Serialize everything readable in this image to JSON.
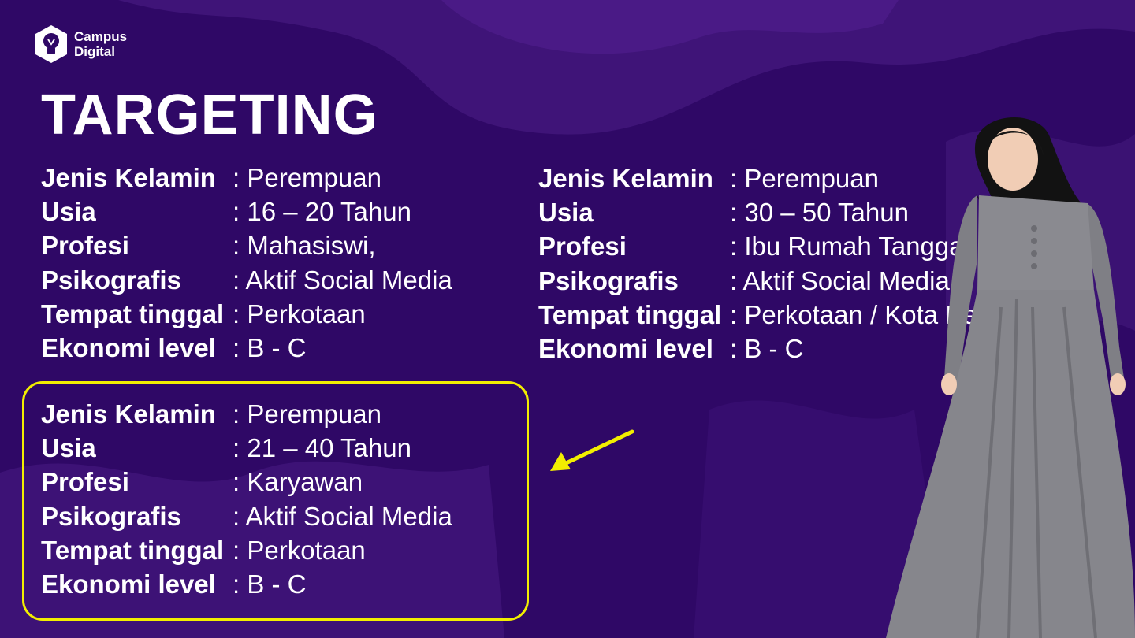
{
  "brand": {
    "line1": "Campus",
    "line2": "Digital"
  },
  "title": "TARGETING",
  "colors": {
    "background": "#2f0866",
    "highlight": "#f2ee00",
    "text": "#ffffff"
  },
  "segments": [
    {
      "rows": [
        {
          "label": "Jenis Kelamin",
          "value": ": Perempuan"
        },
        {
          "label": "Usia",
          "value": ": 16 – 20 Tahun"
        },
        {
          "label": "Profesi",
          "value": ": Mahasiswi,"
        },
        {
          "label": "Psikografis",
          "value": ": Aktif Social Media"
        },
        {
          "label": "Tempat tinggal",
          "value": ": Perkotaan"
        },
        {
          "label": "Ekonomi level",
          "value": ": B - C"
        }
      ]
    },
    {
      "rows": [
        {
          "label": "Jenis Kelamin",
          "value": ": Perempuan"
        },
        {
          "label": "Usia",
          "value": ": 30 – 50 Tahun"
        },
        {
          "label": "Profesi",
          "value": ": Ibu Rumah Tangga"
        },
        {
          "label": "Psikografis",
          "value": ": Aktif Social Media"
        },
        {
          "label": "Tempat tinggal",
          "value": ": Perkotaan / Kota Perdesaan"
        },
        {
          "label": "Ekonomi level",
          "value": ": B - C"
        }
      ]
    },
    {
      "rows": [
        {
          "label": "Jenis Kelamin",
          "value": ": Perempuan"
        },
        {
          "label": "Usia",
          "value": ": 21 – 40 Tahun"
        },
        {
          "label": "Profesi",
          "value": ": Karyawan"
        },
        {
          "label": "Psikografis",
          "value": ": Aktif Social Media"
        },
        {
          "label": "Tempat tinggal",
          "value": ": Perkotaan"
        },
        {
          "label": "Ekonomi level",
          "value": ": B - C"
        }
      ]
    }
  ],
  "icons": {
    "logo": "hexagon-bulb-icon",
    "arrow": "pointer-arrow-icon"
  }
}
